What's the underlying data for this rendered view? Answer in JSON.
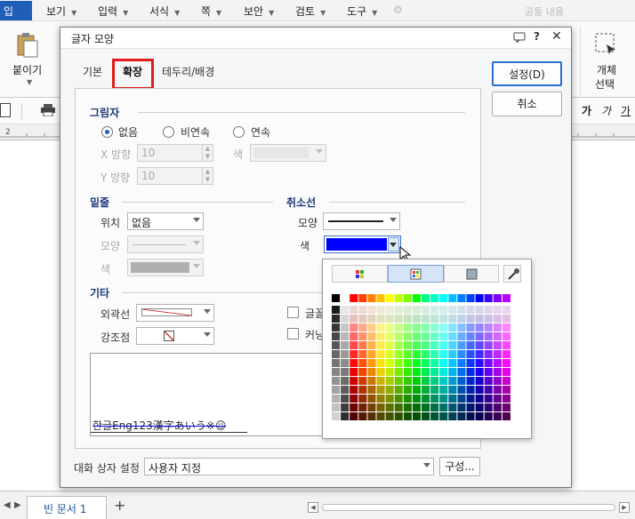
{
  "menubar": {
    "first": "입",
    "items": [
      {
        "label": "보기"
      },
      {
        "label": "입력"
      },
      {
        "label": "서식"
      },
      {
        "label": "쪽"
      },
      {
        "label": "보안"
      },
      {
        "label": "검토"
      },
      {
        "label": "도구"
      }
    ],
    "right_label": "공통 내용"
  },
  "toolbar": {
    "paste_label": "붙이기",
    "object_label_1": "개체",
    "object_label_2": "선택",
    "format_bold": "가",
    "format_italic": "가"
  },
  "dialog": {
    "title": "글자 모양",
    "help": "?",
    "tabs": [
      {
        "label": "기본"
      },
      {
        "label": "확장"
      },
      {
        "label": "테두리/배경"
      }
    ],
    "active_tab": "확장",
    "shadow": {
      "title": "그림자",
      "options": [
        "없음",
        "비연속",
        "연속"
      ],
      "selected": "없음",
      "x_label": "X 방향",
      "x_value": "10",
      "y_label": "Y 방향",
      "y_value": "10",
      "color_label": "색"
    },
    "underline": {
      "title": "밑줄",
      "position_label": "위치",
      "position_value": "없음",
      "shape_label": "모양",
      "color_label": "색"
    },
    "strikethrough": {
      "title": "취소선",
      "shape_label": "모양",
      "color_label": "색",
      "color_value": "#0000ff"
    },
    "etc": {
      "title": "기타",
      "outline_label": "외곽선",
      "emphasis_label": "강조점",
      "checkbox_1": "글꼴",
      "checkbox_2": "커닝"
    },
    "preview_text": "한글Eng123漢字あいう※☺",
    "buttons": {
      "ok": "설정(D)",
      "cancel": "취소"
    },
    "footer": {
      "label": "대화 상자 설정",
      "value": "사용자 지정",
      "config_button": "구성..."
    }
  },
  "statusbar": {
    "tab_label": "빈 문서 1",
    "add_label": "+"
  },
  "colors": {
    "accent": "#1f5fb8",
    "highlight_red": "#e21b1b",
    "strike_color": "#0000ff",
    "section_title": "#1e3a78"
  }
}
